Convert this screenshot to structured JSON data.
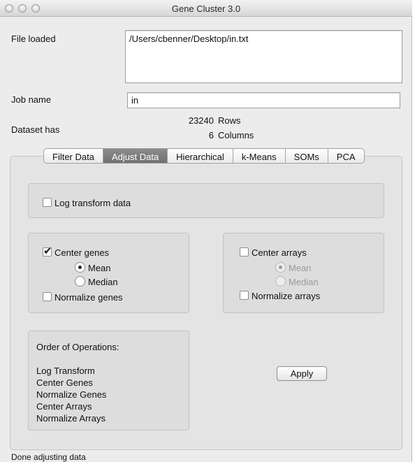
{
  "window": {
    "title": "Gene Cluster 3.0"
  },
  "file": {
    "label": "File loaded",
    "path": "/Users/cbenner/Desktop/in.txt"
  },
  "job": {
    "label": "Job name",
    "value": "in"
  },
  "dataset": {
    "label": "Dataset has",
    "rows": "23240",
    "rows_label": "Rows",
    "columns": "6",
    "columns_label": "Columns"
  },
  "tabs": [
    {
      "label": "Filter Data"
    },
    {
      "label": "Adjust Data"
    },
    {
      "label": "Hierarchical"
    },
    {
      "label": "k-Means"
    },
    {
      "label": "SOMs"
    },
    {
      "label": "PCA"
    }
  ],
  "adjust": {
    "log_transform": {
      "label": "Log transform data",
      "checked": false
    },
    "center_genes": {
      "label": "Center genes",
      "checked": true,
      "mean": "Mean",
      "median": "Median",
      "selected": "Mean"
    },
    "normalize_genes": {
      "label": "Normalize genes",
      "checked": false
    },
    "center_arrays": {
      "label": "Center arrays",
      "checked": false,
      "mean": "Mean",
      "median": "Median",
      "selected": "Mean"
    },
    "normalize_arrays": {
      "label": "Normalize arrays",
      "checked": false
    },
    "order": {
      "title": "Order of Operations:",
      "items": [
        "Log Transform",
        "Center Genes",
        "Normalize Genes",
        "Center Arrays",
        "Normalize Arrays"
      ]
    },
    "apply_label": "Apply"
  },
  "status": "Done adjusting data"
}
